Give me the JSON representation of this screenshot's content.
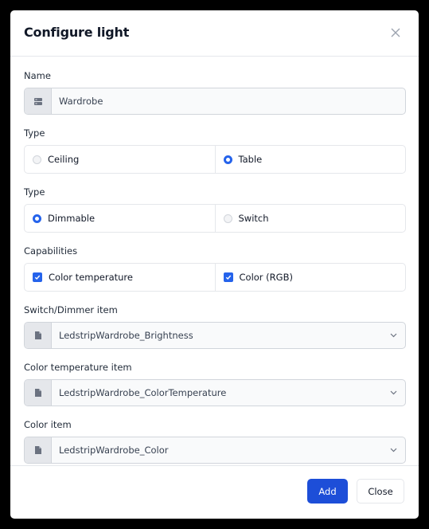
{
  "dialog": {
    "title": "Configure light",
    "close_icon": "close-icon"
  },
  "name_field": {
    "label": "Name",
    "value": "Wardrobe",
    "icon": "server-icon"
  },
  "type_group_1": {
    "label": "Type",
    "options": [
      {
        "label": "Ceiling",
        "selected": false
      },
      {
        "label": "Table",
        "selected": true
      }
    ]
  },
  "type_group_2": {
    "label": "Type",
    "options": [
      {
        "label": "Dimmable",
        "selected": true
      },
      {
        "label": "Switch",
        "selected": false
      }
    ]
  },
  "capabilities": {
    "label": "Capabilities",
    "options": [
      {
        "label": "Color temperature",
        "checked": true
      },
      {
        "label": "Color (RGB)",
        "checked": true
      }
    ]
  },
  "switch_dimmer_item": {
    "label": "Switch/Dimmer item",
    "value": "LedstripWardrobe_Brightness",
    "icon": "file-icon"
  },
  "color_temperature_item": {
    "label": "Color temperature item",
    "value": "LedstripWardrobe_ColorTemperature",
    "icon": "file-icon"
  },
  "color_item": {
    "label": "Color item",
    "value": "LedstripWardrobe_Color",
    "icon": "file-icon"
  },
  "footer": {
    "add_label": "Add",
    "close_label": "Close"
  },
  "colors": {
    "primary": "#1d4ed8",
    "accent": "#2563eb"
  }
}
